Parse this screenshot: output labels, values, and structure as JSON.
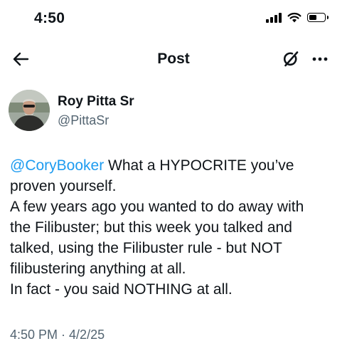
{
  "status_bar": {
    "time": "4:50"
  },
  "nav": {
    "title": "Post"
  },
  "author": {
    "display_name": "Roy Pitta Sr",
    "handle": "@PittaSr"
  },
  "tweet": {
    "mention": "@CoryBooker",
    "line1_rest": " What a HYPOCRITE you’ve",
    "line2": "proven yourself.",
    "line3": "A few years ago you wanted to do away with",
    "line4": "the Filibuster; but this week you talked and",
    "line5": "talked, using the Filibuster rule - but NOT",
    "line6": "filibustering anything at all.",
    "line7": "In fact - you said NOTHING at all."
  },
  "meta": {
    "time": "4:50 PM",
    "separator": " · ",
    "date": "4/2/25"
  },
  "colors": {
    "link": "#1d9bf0",
    "secondary_text": "#536471",
    "primary_text": "#0f1419"
  },
  "icons": {
    "back": "arrow-left-icon",
    "grok": "grok-icon",
    "more": "more-horizontal-icon"
  }
}
